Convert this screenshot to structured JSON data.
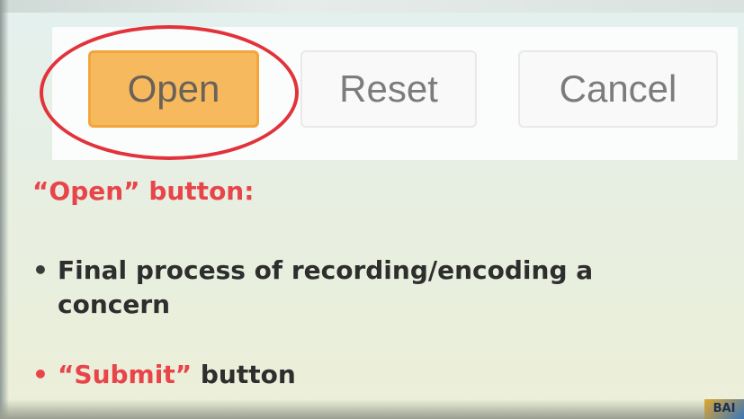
{
  "buttons": {
    "open_label": "Open",
    "reset_label": "Reset",
    "cancel_label": "Cancel"
  },
  "slide": {
    "heading": "“Open” button:",
    "bullet_1": "Final process of recording/encoding a concern",
    "bullet_2": {
      "emphasis": "“Submit”",
      "rest": " button"
    },
    "corner_mark": "BAI"
  },
  "colors": {
    "open_button": "#f6b95e",
    "highlight_ring": "#e2323a",
    "heading": "#e8454b",
    "body_text": "#2e2e2e"
  }
}
